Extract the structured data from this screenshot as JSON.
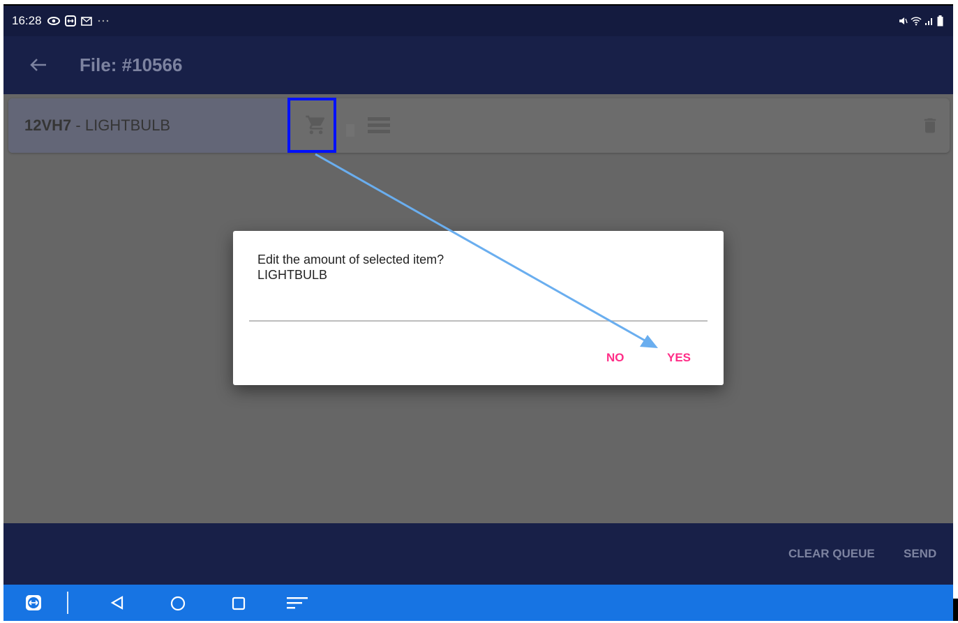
{
  "status_bar": {
    "time": "16:28",
    "icons": [
      "eye-icon",
      "remote-app-icon",
      "mail-icon",
      "more-dots-icon"
    ],
    "right_icons": [
      "mute-icon",
      "wifi-icon",
      "signal-icon",
      "battery-icon"
    ]
  },
  "app_bar": {
    "back_icon": "arrow-left-icon",
    "title": "File: #10566"
  },
  "item": {
    "code": "12VH7",
    "separator": " - ",
    "name": "LIGHTBULB",
    "icons": [
      "cart-icon",
      "list-icon",
      "trash-icon"
    ]
  },
  "dialog": {
    "message_line1": "Edit the amount of selected item?",
    "message_line2": "LIGHTBULB",
    "input_value": "",
    "no_label": "NO",
    "yes_label": "YES"
  },
  "bottom_bar": {
    "clear_queue_label": "CLEAR QUEUE",
    "send_label": "SEND"
  },
  "nav_bar": {
    "icons": [
      "teamviewer-icon",
      "back-triangle-icon",
      "home-circle-icon",
      "recents-square-icon",
      "menu-lines-icon"
    ]
  },
  "colors": {
    "app_bar": "#182048",
    "nav_bar": "#1774e3",
    "dialog_accent": "#ff2d87",
    "annotation_box": "#0010ff",
    "annotation_arrow": "#6aaeef",
    "overlay": "#666666"
  }
}
